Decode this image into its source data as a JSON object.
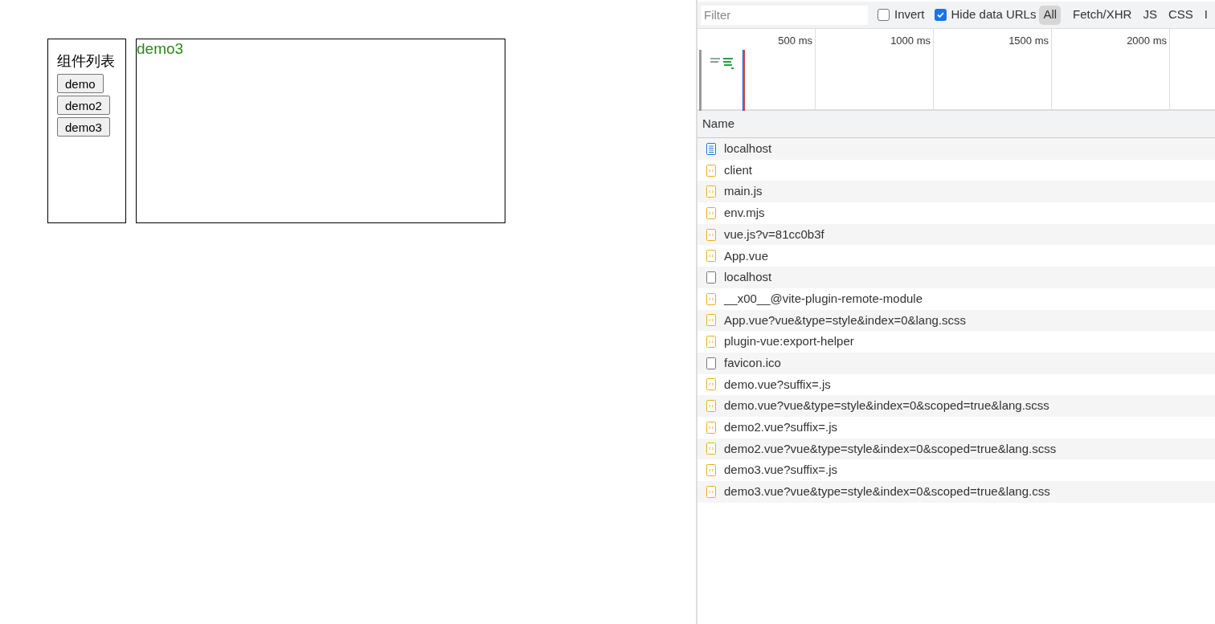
{
  "page": {
    "sidebar": {
      "title": "组件列表",
      "buttons": [
        "demo",
        "demo2",
        "demo3"
      ]
    },
    "content": {
      "text": "demo3"
    }
  },
  "devtools": {
    "filter": {
      "placeholder": "Filter"
    },
    "invert": {
      "label": "Invert",
      "checked": false
    },
    "hide_data_urls": {
      "label": "Hide data URLs",
      "checked": true
    },
    "type_filters": [
      {
        "label": "All",
        "selected": true
      },
      {
        "label": "Fetch/XHR",
        "selected": false
      },
      {
        "label": "JS",
        "selected": false
      },
      {
        "label": "CSS",
        "selected": false
      },
      {
        "label": "I",
        "selected": false
      }
    ],
    "timeline": {
      "ticks": [
        "500 ms",
        "1000 ms",
        "1500 ms",
        "2000 ms"
      ]
    },
    "table": {
      "columns": [
        "Name"
      ],
      "rows": [
        {
          "name": "localhost",
          "kind": "document"
        },
        {
          "name": "client",
          "kind": "script"
        },
        {
          "name": "main.js",
          "kind": "script"
        },
        {
          "name": "env.mjs",
          "kind": "script"
        },
        {
          "name": "vue.js?v=81cc0b3f",
          "kind": "script"
        },
        {
          "name": "App.vue",
          "kind": "script"
        },
        {
          "name": "localhost",
          "kind": "other"
        },
        {
          "name": "__x00__@vite-plugin-remote-module",
          "kind": "script"
        },
        {
          "name": "App.vue?vue&type=style&index=0&lang.scss",
          "kind": "script"
        },
        {
          "name": "plugin-vue:export-helper",
          "kind": "script"
        },
        {
          "name": "favicon.ico",
          "kind": "other"
        },
        {
          "name": "demo.vue?suffix=.js",
          "kind": "script"
        },
        {
          "name": "demo.vue?vue&type=style&index=0&scoped=true&lang.scss",
          "kind": "script"
        },
        {
          "name": "demo2.vue?suffix=.js",
          "kind": "script"
        },
        {
          "name": "demo2.vue?vue&type=style&index=0&scoped=true&lang.scss",
          "kind": "script"
        },
        {
          "name": "demo3.vue?suffix=.js",
          "kind": "script"
        },
        {
          "name": "demo3.vue?vue&type=style&index=0&scoped=true&lang.css",
          "kind": "script"
        }
      ]
    }
  }
}
